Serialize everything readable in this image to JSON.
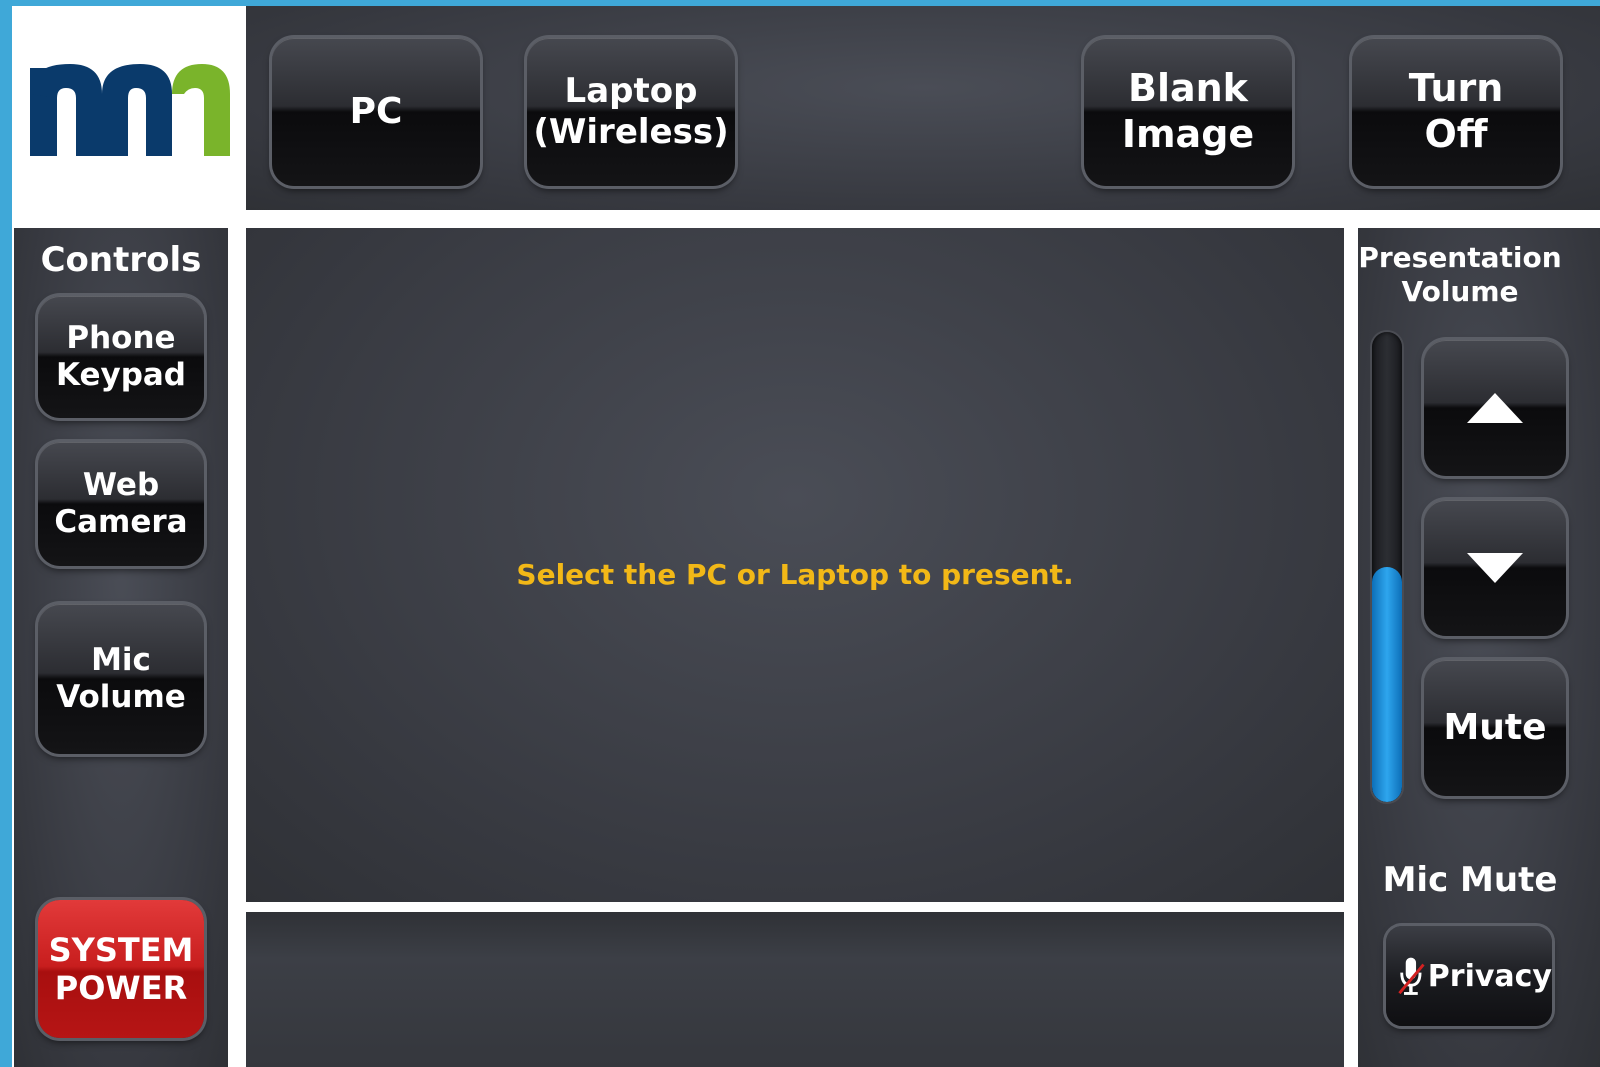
{
  "top_buttons": {
    "pc": "PC",
    "laptop": "Laptop\n(Wireless)",
    "blank": "Blank\nImage",
    "turn_off": "Turn\nOff"
  },
  "controls": {
    "heading": "Controls",
    "phone_keypad": "Phone\nKeypad",
    "web_camera": "Web\nCamera",
    "mic_volume": "Mic\nVolume",
    "system_power": "SYSTEM\nPOWER"
  },
  "main": {
    "prompt": "Select the PC or Laptop to present."
  },
  "presentation_volume": {
    "heading": "Presentation\nVolume",
    "level": 0.5,
    "up_icon": "triangle-up-icon",
    "down_icon": "triangle-down-icon",
    "mute": "Mute"
  },
  "mic_mute": {
    "heading": "Mic Mute",
    "privacy": "Privacy",
    "icon": "muted-microphone-icon"
  },
  "logo": {
    "text": "mn",
    "colors": {
      "navy": "#0a3a6b",
      "green": "#7ab42b"
    }
  },
  "colors": {
    "accent_blue": "#3fa8d8",
    "prompt_yellow": "#f2b817",
    "power_red": "#c81e1e",
    "slider_blue": "#2ea6ee"
  }
}
